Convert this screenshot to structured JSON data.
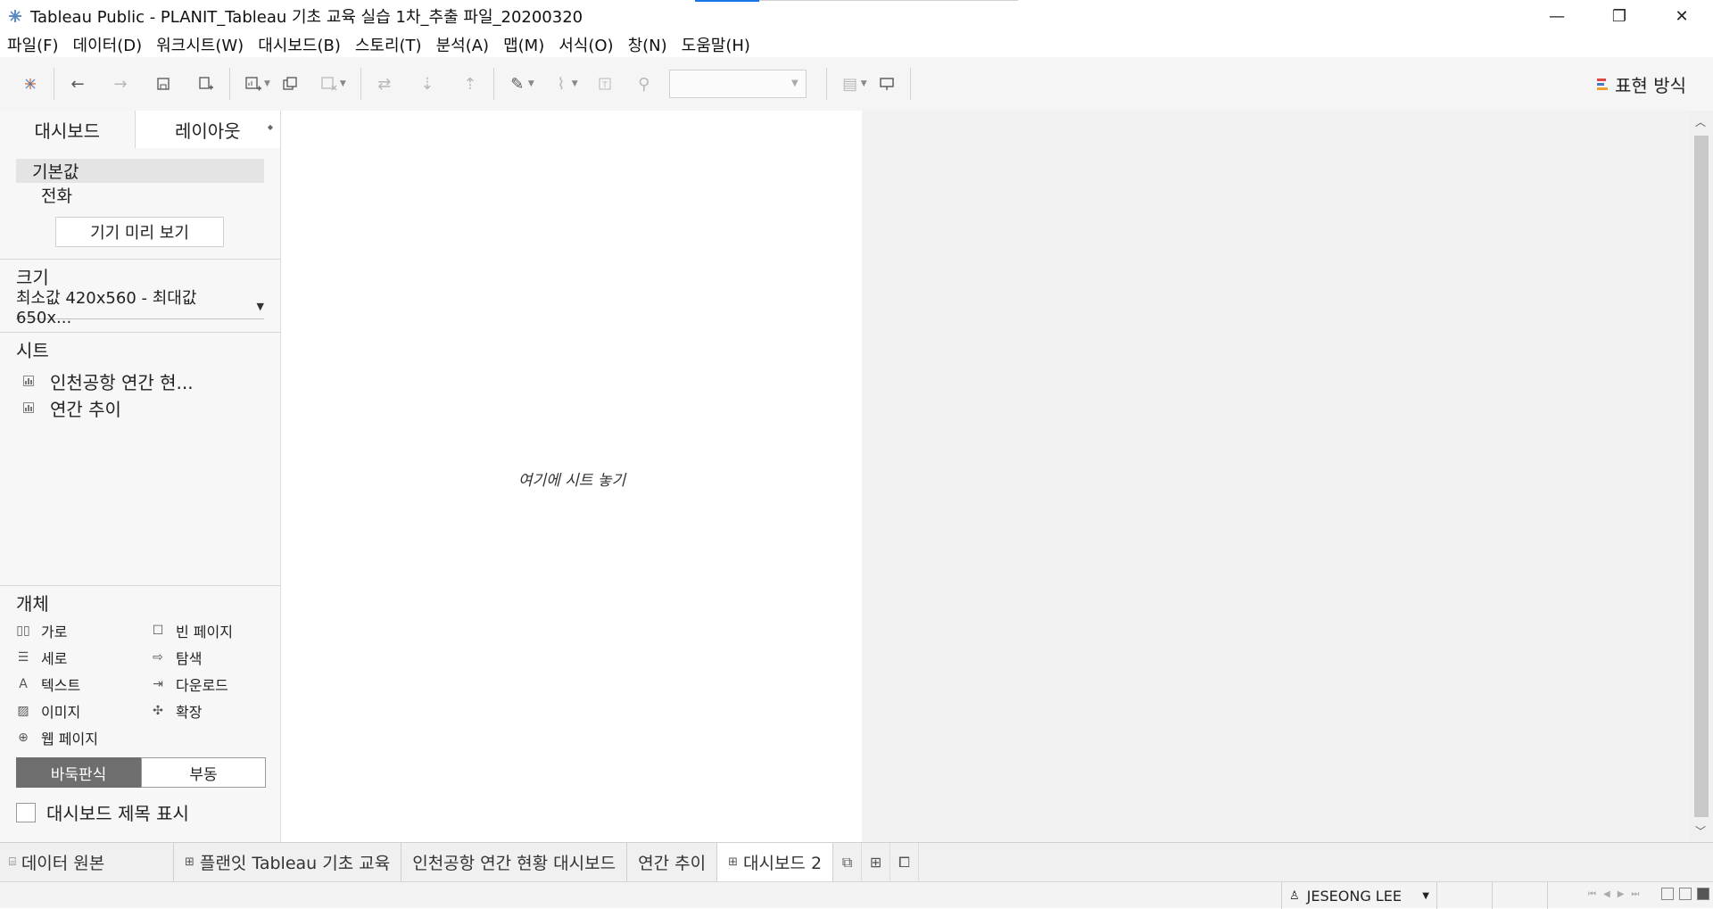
{
  "window": {
    "title": "Tableau Public - PLANIT_Tableau 기초 교육 실습 1차_추출 파일_20200320",
    "controls": {
      "minimize": "—",
      "restore": "❐",
      "close": "✕"
    }
  },
  "menu": [
    "파일(F)",
    "데이터(D)",
    "워크시트(W)",
    "대시보드(B)",
    "스토리(T)",
    "분석(A)",
    "맵(M)",
    "서식(O)",
    "창(N)",
    "도움말(H)"
  ],
  "toolbar": {
    "show_me_label": "표현 방식",
    "show_me_colors": [
      "#e0474c",
      "#4a78c2",
      "#f0a030"
    ]
  },
  "left_panel": {
    "tabs": {
      "dashboard": "대시보드",
      "layout": "레이아웃"
    },
    "devices": {
      "default": "기본값",
      "phone": "전화"
    },
    "device_preview_button": "기기 미리 보기",
    "size": {
      "title": "크기",
      "value": "최소값 420x560 - 최대값 650x..."
    },
    "sheets": {
      "title": "시트",
      "items": [
        "인천공항 연간 현...",
        "연간 추이"
      ]
    },
    "objects": {
      "title": "개체",
      "items": [
        {
          "label": "가로",
          "icon": "horizontal-icon"
        },
        {
          "label": "빈 페이지",
          "icon": "blank-icon"
        },
        {
          "label": "세로",
          "icon": "vertical-icon"
        },
        {
          "label": "탐색",
          "icon": "navigation-icon"
        },
        {
          "label": "텍스트",
          "icon": "text-icon"
        },
        {
          "label": "다운로드",
          "icon": "download-icon"
        },
        {
          "label": "이미지",
          "icon": "image-icon"
        },
        {
          "label": "확장",
          "icon": "extension-icon"
        },
        {
          "label": "웹 페이지",
          "icon": "web-page-icon"
        }
      ]
    },
    "layout_mode": {
      "tiled": "바둑판식",
      "floating": "부동",
      "selected": "tiled"
    },
    "show_title_checkbox": {
      "label": "대시보드 제목 표시",
      "checked": false
    }
  },
  "canvas": {
    "drop_hint": "여기에 시트 놓기"
  },
  "bottom_tabs": {
    "data_source": "데이터 원본",
    "tabs": [
      {
        "label": "플랜잇 Tableau 기초 교육",
        "type": "dashboard"
      },
      {
        "label": "인천공항 연간 현황 대시보드",
        "type": "sheet"
      },
      {
        "label": "연간 추이",
        "type": "sheet"
      },
      {
        "label": "대시보드 2",
        "type": "dashboard",
        "active": true
      }
    ]
  },
  "status_bar": {
    "user": "JESEONG LEE"
  }
}
